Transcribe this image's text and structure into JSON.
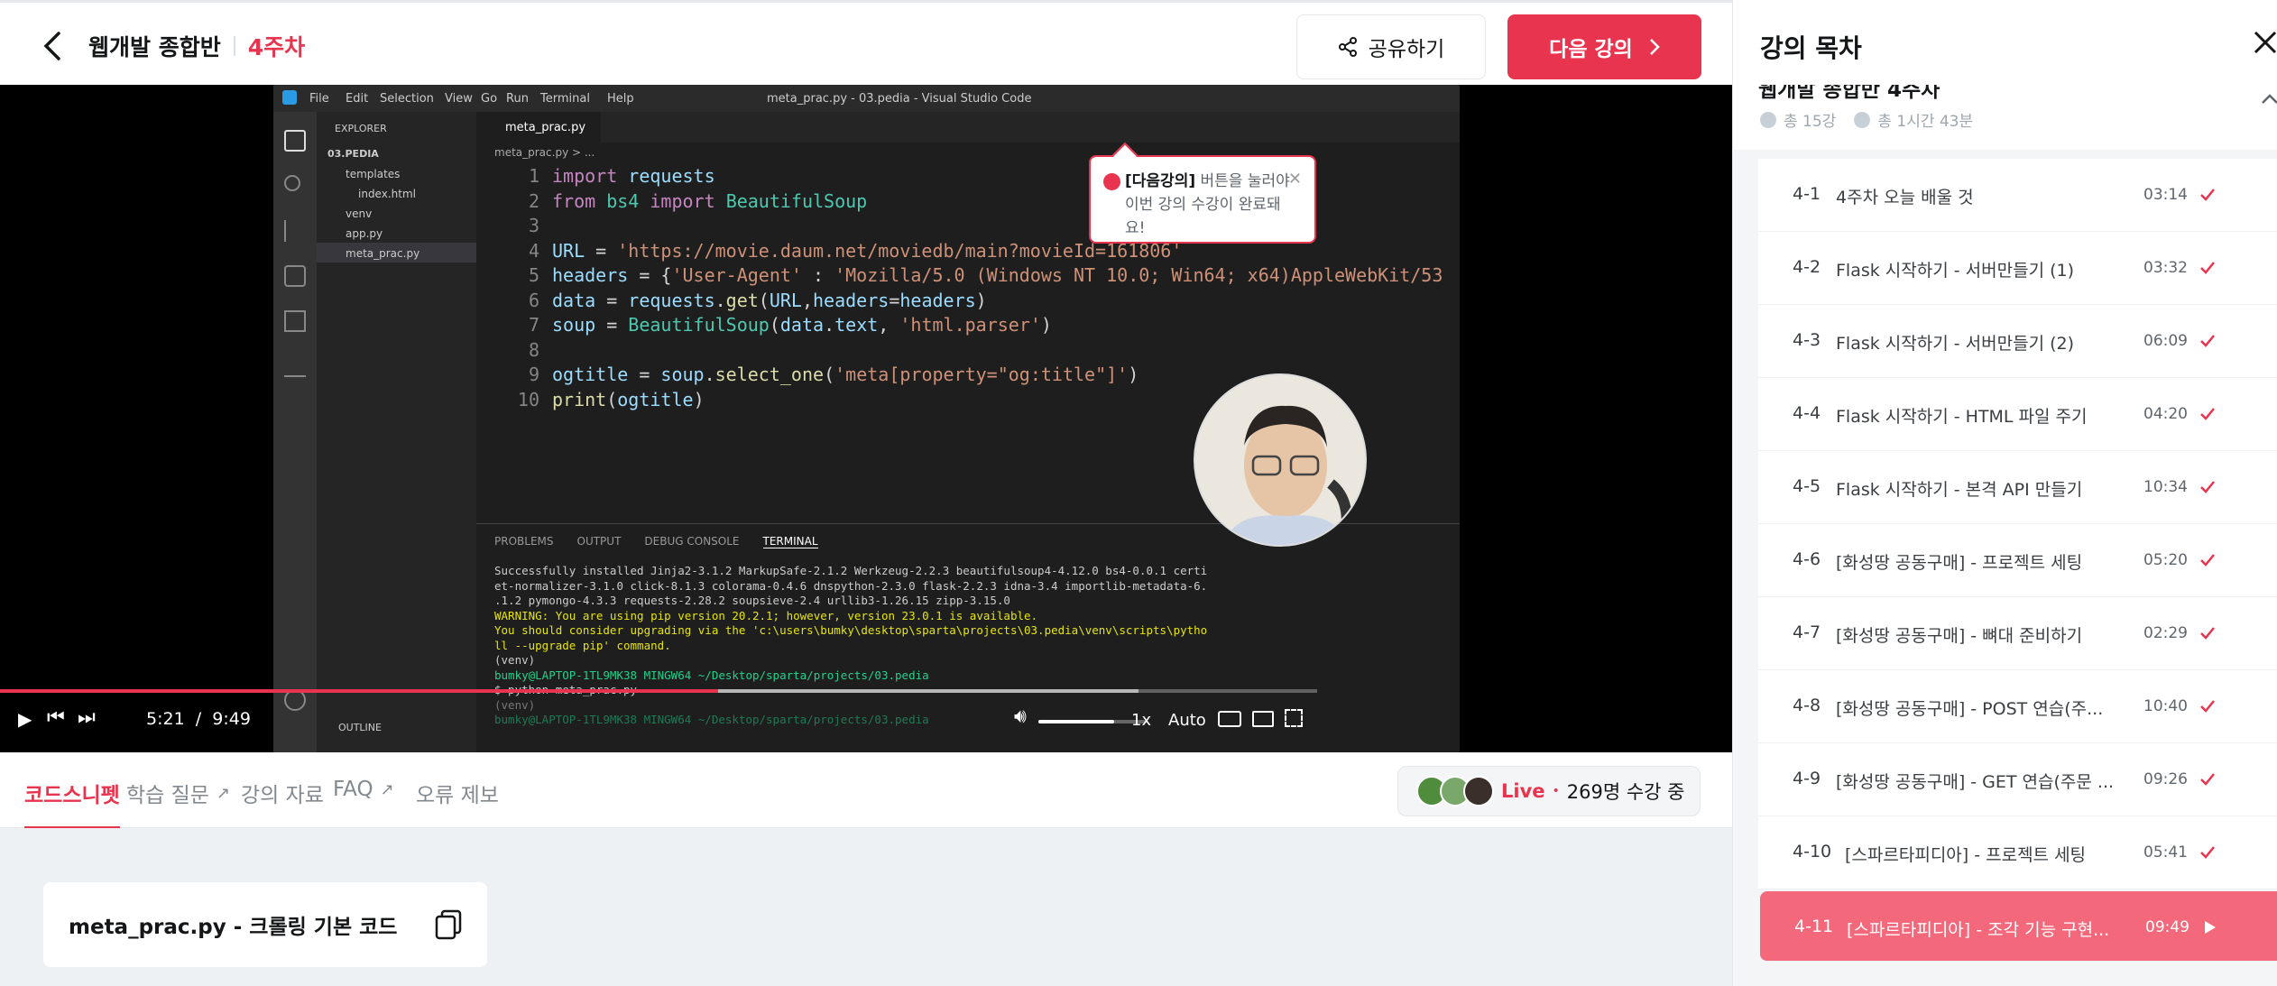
{
  "header": {
    "course": "웹개발 종합반",
    "week": "4주차",
    "share_label": "공유하기",
    "next_label": "다음 강의"
  },
  "video": {
    "vscode": {
      "menu": [
        "File",
        "Edit",
        "Selection",
        "View",
        "Go",
        "Run",
        "Terminal",
        "Help"
      ],
      "window_title": "meta_prac.py - 03.pedia - Visual Studio Code",
      "explorer_title": "EXPLORER",
      "tree": [
        "03.PEDIA",
        "templates",
        "index.html",
        "venv",
        "app.py",
        "meta_prac.py"
      ],
      "tab": "meta_prac.py",
      "breadcrumb": "meta_prac.py > ...",
      "outline": "OUTLINE",
      "panel_tabs": [
        "PROBLEMS",
        "OUTPUT",
        "DEBUG CONSOLE",
        "TERMINAL"
      ],
      "terminal": [
        "Successfully installed Jinja2-3.1.2 MarkupSafe-2.1.2 Werkzeug-2.2.3 beautifulsoup4-4.12.0 bs4-0.0.1 certi",
        "et-normalizer-3.1.0 click-8.1.3 colorama-0.4.6 dnspython-2.3.0 flask-2.2.3 idna-3.4 importlib-metadata-6.",
        ".1.2 pymongo-4.3.3 requests-2.28.2 soupsieve-2.4 urllib3-1.26.15 zipp-3.15.0",
        "WARNING: You are using pip version 20.2.1; however, version 23.0.1 is available.",
        "You should consider upgrading via the 'c:\\users\\bumky\\desktop\\sparta\\projects\\03.pedia\\venv\\scripts\\pytho",
        "ll --upgrade pip' command.",
        "(venv)",
        "bumky@LAPTOP-1TL9MK38 MINGW64 ~/Desktop/sparta/projects/03.pedia",
        "$ python meta_prac.py",
        "",
        "(venv)",
        "bumky@LAPTOP-1TL9MK38 MINGW64 ~/Desktop/sparta/projects/03.pedia"
      ]
    },
    "callout": {
      "bold": "[다음강의]",
      "line1": " 버튼을 눌러야",
      "line2": "이번 강의 수강이 완료돼요!"
    },
    "time_current": "5:21",
    "time_sep": "/",
    "time_total": "9:49",
    "progress": 0.545,
    "volume": 0.7,
    "speed": "1x",
    "quality": "Auto"
  },
  "tabs": [
    "코드스니펫",
    "학습 질문",
    "강의 자료",
    "FAQ",
    "오류 제보"
  ],
  "live": {
    "label": "Live",
    "dot": "•",
    "count": "269명 수강 중"
  },
  "snippet": {
    "title": "meta_prac.py - 크롤링 기본 코드"
  },
  "sidebar": {
    "title": "강의 목차",
    "section_cut": "웹개발 종합반 4주차",
    "total_lectures": "총 15강",
    "total_time": "총 1시간 43분",
    "items": [
      {
        "num": "4-1",
        "title": "4주차 오늘 배울 것",
        "dur": "03:14"
      },
      {
        "num": "4-2",
        "title": "Flask 시작하기 - 서버만들기 (1)",
        "dur": "03:32"
      },
      {
        "num": "4-3",
        "title": "Flask 시작하기 - 서버만들기 (2)",
        "dur": "06:09"
      },
      {
        "num": "4-4",
        "title": "Flask 시작하기 - HTML 파일 주기",
        "dur": "04:20"
      },
      {
        "num": "4-5",
        "title": "Flask 시작하기 - 본격 API 만들기",
        "dur": "10:34"
      },
      {
        "num": "4-6",
        "title": "[화성땅 공동구매] - 프로젝트 세팅",
        "dur": "05:20"
      },
      {
        "num": "4-7",
        "title": "[화성땅 공동구매] - 뼈대 준비하기",
        "dur": "02:29"
      },
      {
        "num": "4-8",
        "title": "[화성땅 공동구매] - POST 연습(주...",
        "dur": "10:40"
      },
      {
        "num": "4-9",
        "title": "[화성땅 공동구매] - GET 연습(주문 ...",
        "dur": "09:26"
      },
      {
        "num": "4-10",
        "title": "[스파르타피디아] - 프로젝트 세팅",
        "dur": "05:41"
      },
      {
        "num": "4-11",
        "title": "[스파르타피디아] - 조각 기능 구현...",
        "dur": "09:49"
      }
    ]
  },
  "colors": {
    "accent": "#e8344e",
    "current_item": "#f4687b"
  }
}
